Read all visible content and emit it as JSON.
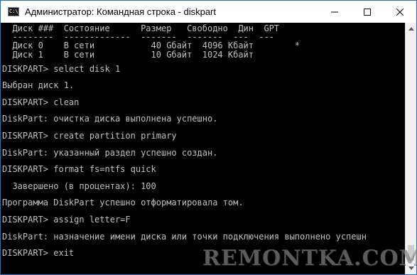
{
  "window": {
    "title": "Администратор: Командная строка - diskpart",
    "icon_text": "C:\\",
    "accent_color": "#2b6cb8"
  },
  "controls": {
    "minimize": "minimize-icon",
    "maximize": "maximize-icon",
    "close": "close-icon"
  },
  "console": {
    "lines": [
      "  Диск ###  Состояние      Размер   Свободно  Дин  GPT",
      "  --------  -------------  -------  -------  ---  ---",
      "  Диск 0    В сети           40 Gбайт  4096 Kбайт        *",
      "  Диск 1    В сети           10 Gбайт  1024 Kбайт",
      "",
      "DISKPART> select disk 1",
      "",
      "Выбран диск 1.",
      "",
      "DISKPART> clean",
      "",
      "DiskPart: очистка диска выполнена успешно.",
      "",
      "DISKPART> create partition primary",
      "",
      "DiskPart: указанный раздел успешно создан.",
      "",
      "DISKPART> format fs=ntfs quick",
      "",
      "  Завершено (в процентах): 100",
      "",
      "Программа DiskPart успешно отформатировала том.",
      "",
      "DISKPART> assign letter=F",
      "",
      "DiskPart: назначение имени диска или точки подключения выполнено успешн",
      "",
      "DISKPART> exit"
    ],
    "text_color": "#c0c0c0",
    "background": "#000000"
  },
  "watermark": "REMONTKA.COM"
}
